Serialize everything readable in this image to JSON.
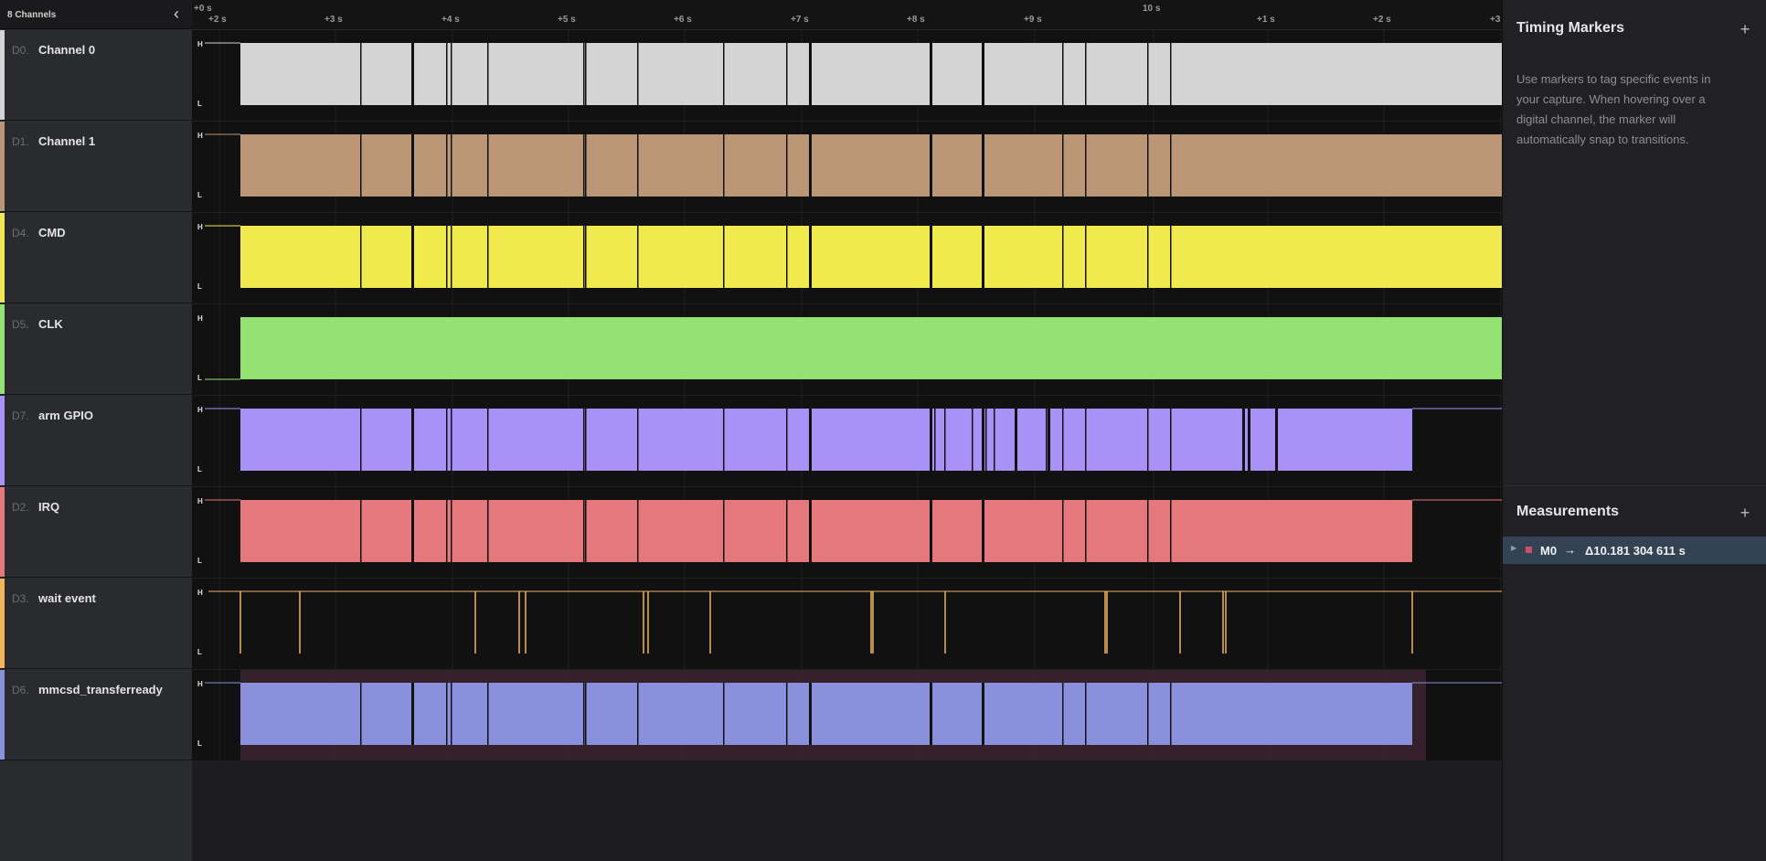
{
  "channels_panel": {
    "count_label": "8 Channels",
    "collapse_icon": "chevron-left-icon"
  },
  "channels": [
    {
      "index": "D0.",
      "name": "Channel 0",
      "color": "#d4d4d4",
      "mode": "full"
    },
    {
      "index": "D1.",
      "name": "Channel 1",
      "color": "#bb9677",
      "mode": "full"
    },
    {
      "index": "D4.",
      "name": "CMD",
      "color": "#f1ea4e",
      "mode": "full"
    },
    {
      "index": "D5.",
      "name": "CLK",
      "color": "#94e272",
      "mode": "solid"
    },
    {
      "index": "D7.",
      "name": "arm GPIO",
      "color": "#a891f7",
      "mode": "gpio"
    },
    {
      "index": "D2.",
      "name": "IRQ",
      "color": "#e4787c",
      "mode": "short"
    },
    {
      "index": "D3.",
      "name": "wait event",
      "color": "#f0b45c",
      "mode": "pulses"
    },
    {
      "index": "D6.",
      "name": "mmcsd_transferready",
      "color": "#8b90dd",
      "mode": "short"
    }
  ],
  "ruler": {
    "origin_label": "+0 s",
    "ticks": [
      "+2 s",
      "+3 s",
      "+4 s",
      "+5 s",
      "+6 s",
      "+7 s",
      "+8 s",
      "+9 s",
      "10 s",
      "+1 s",
      "+2 s",
      "+3"
    ]
  },
  "levels": {
    "high": "H",
    "low": "L"
  },
  "timing_markers": {
    "title": "Timing Markers",
    "add_icon": "plus-icon",
    "add_label": "+",
    "description": "Use markers to tag specific events in your capture. When hovering over a digital channel, the marker will automatically snap to transitions."
  },
  "measurements": {
    "title": "Measurements",
    "add_label": "+",
    "items": [
      {
        "name": "M0",
        "arrow": "→",
        "value": "Δ10.181 304 611 s",
        "color": "#c94f6a"
      }
    ]
  }
}
